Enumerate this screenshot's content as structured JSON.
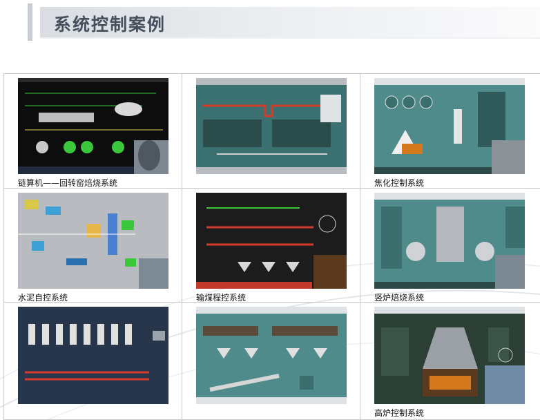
{
  "page": {
    "title": "系统控制案例"
  },
  "cases": [
    {
      "caption": "链算机——回转窑焙烧系统"
    },
    {
      "caption": ""
    },
    {
      "caption": "焦化控制系统"
    },
    {
      "caption": "水泥自控系统"
    },
    {
      "caption": "输煤程控系统"
    },
    {
      "caption": "竖炉焙烧系统"
    },
    {
      "caption": ""
    },
    {
      "caption": ""
    },
    {
      "caption": "高炉控制系统"
    }
  ],
  "thumbnails": {
    "hmi_panel_colors": [
      "#0d0d0d",
      "#3b7170",
      "#b8bcc0",
      "#1c1c1c",
      "#27364a",
      "#4e8b8a",
      "#2b3f35"
    ]
  }
}
